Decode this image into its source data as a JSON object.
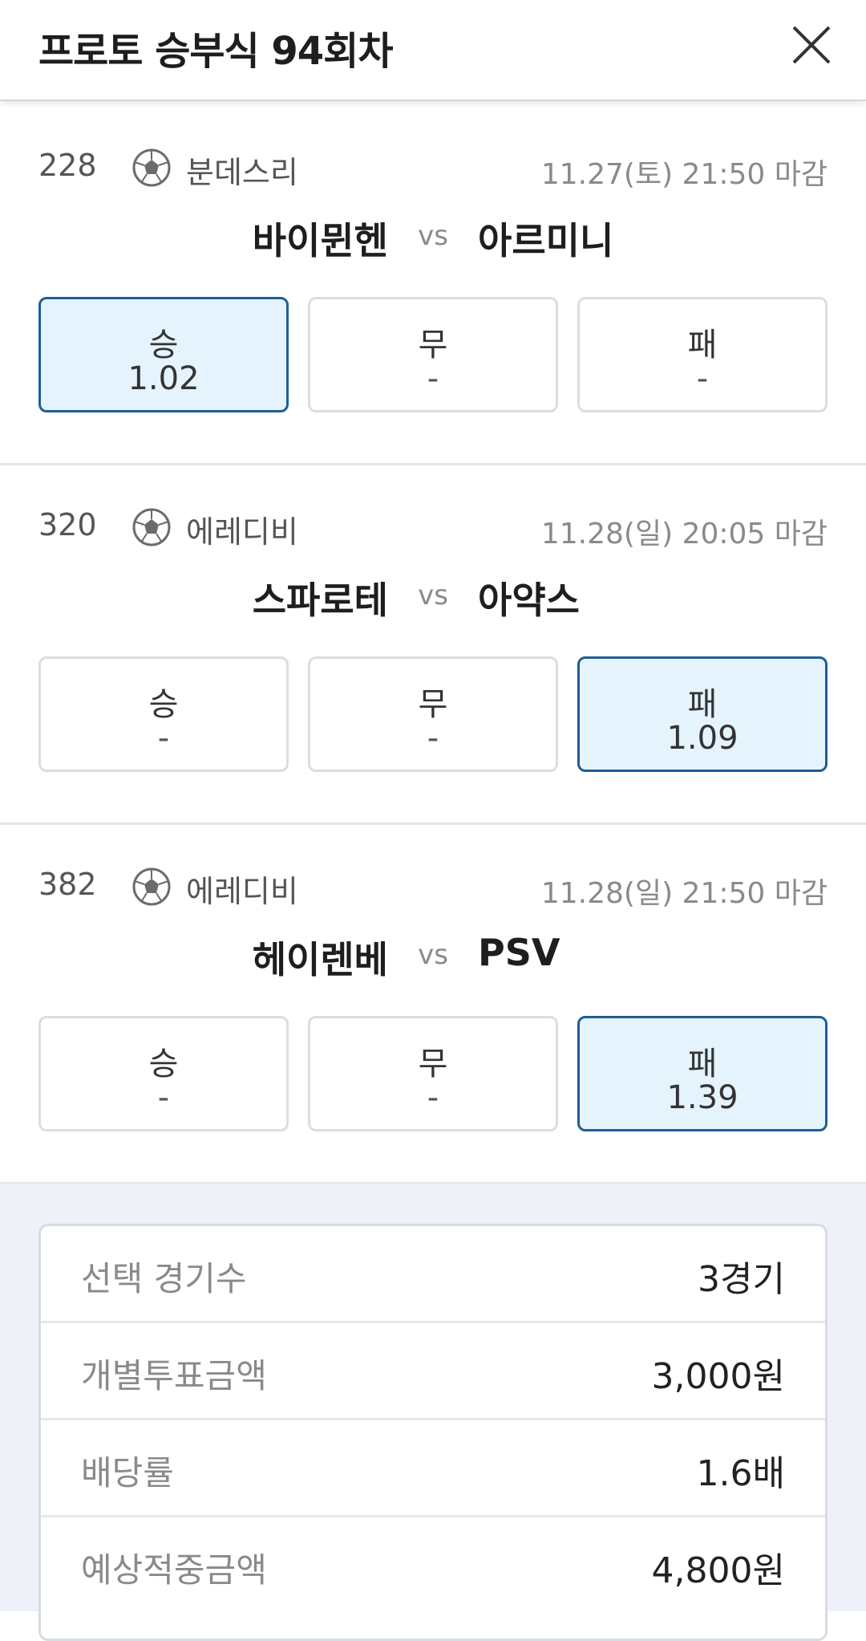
{
  "header": {
    "title": "프로토 승부식 94회차",
    "close_icon": "close-icon"
  },
  "matches": [
    {
      "number": "228",
      "league": "분데스리",
      "deadline": "11.27(토) 21:50 마감",
      "home": "바이뮌헨",
      "vs": "vs",
      "away": "아르미니",
      "options": [
        {
          "label": "승",
          "odds": "1.02",
          "selected": true
        },
        {
          "label": "무",
          "odds": "-",
          "selected": false
        },
        {
          "label": "패",
          "odds": "-",
          "selected": false
        }
      ]
    },
    {
      "number": "320",
      "league": "에레디비",
      "deadline": "11.28(일) 20:05 마감",
      "home": "스파로테",
      "vs": "vs",
      "away": "아약스",
      "options": [
        {
          "label": "승",
          "odds": "-",
          "selected": false
        },
        {
          "label": "무",
          "odds": "-",
          "selected": false
        },
        {
          "label": "패",
          "odds": "1.09",
          "selected": true
        }
      ]
    },
    {
      "number": "382",
      "league": "에레디비",
      "deadline": "11.28(일) 21:50 마감",
      "home": "헤이렌베",
      "vs": "vs",
      "away": "PSV",
      "options": [
        {
          "label": "승",
          "odds": "-",
          "selected": false
        },
        {
          "label": "무",
          "odds": "-",
          "selected": false
        },
        {
          "label": "패",
          "odds": "1.39",
          "selected": true
        }
      ]
    }
  ],
  "summary": [
    {
      "label": "선택 경기수",
      "value": "3경기"
    },
    {
      "label": "개별투표금액",
      "value": "3,000원"
    },
    {
      "label": "배당률",
      "value": "1.6배"
    },
    {
      "label": "예상적중금액",
      "value": "4,800원"
    }
  ],
  "colors": {
    "selected_bg": "#e4f3fc",
    "selected_border": "#1e5e95",
    "summary_bg": "#eef1f7"
  }
}
